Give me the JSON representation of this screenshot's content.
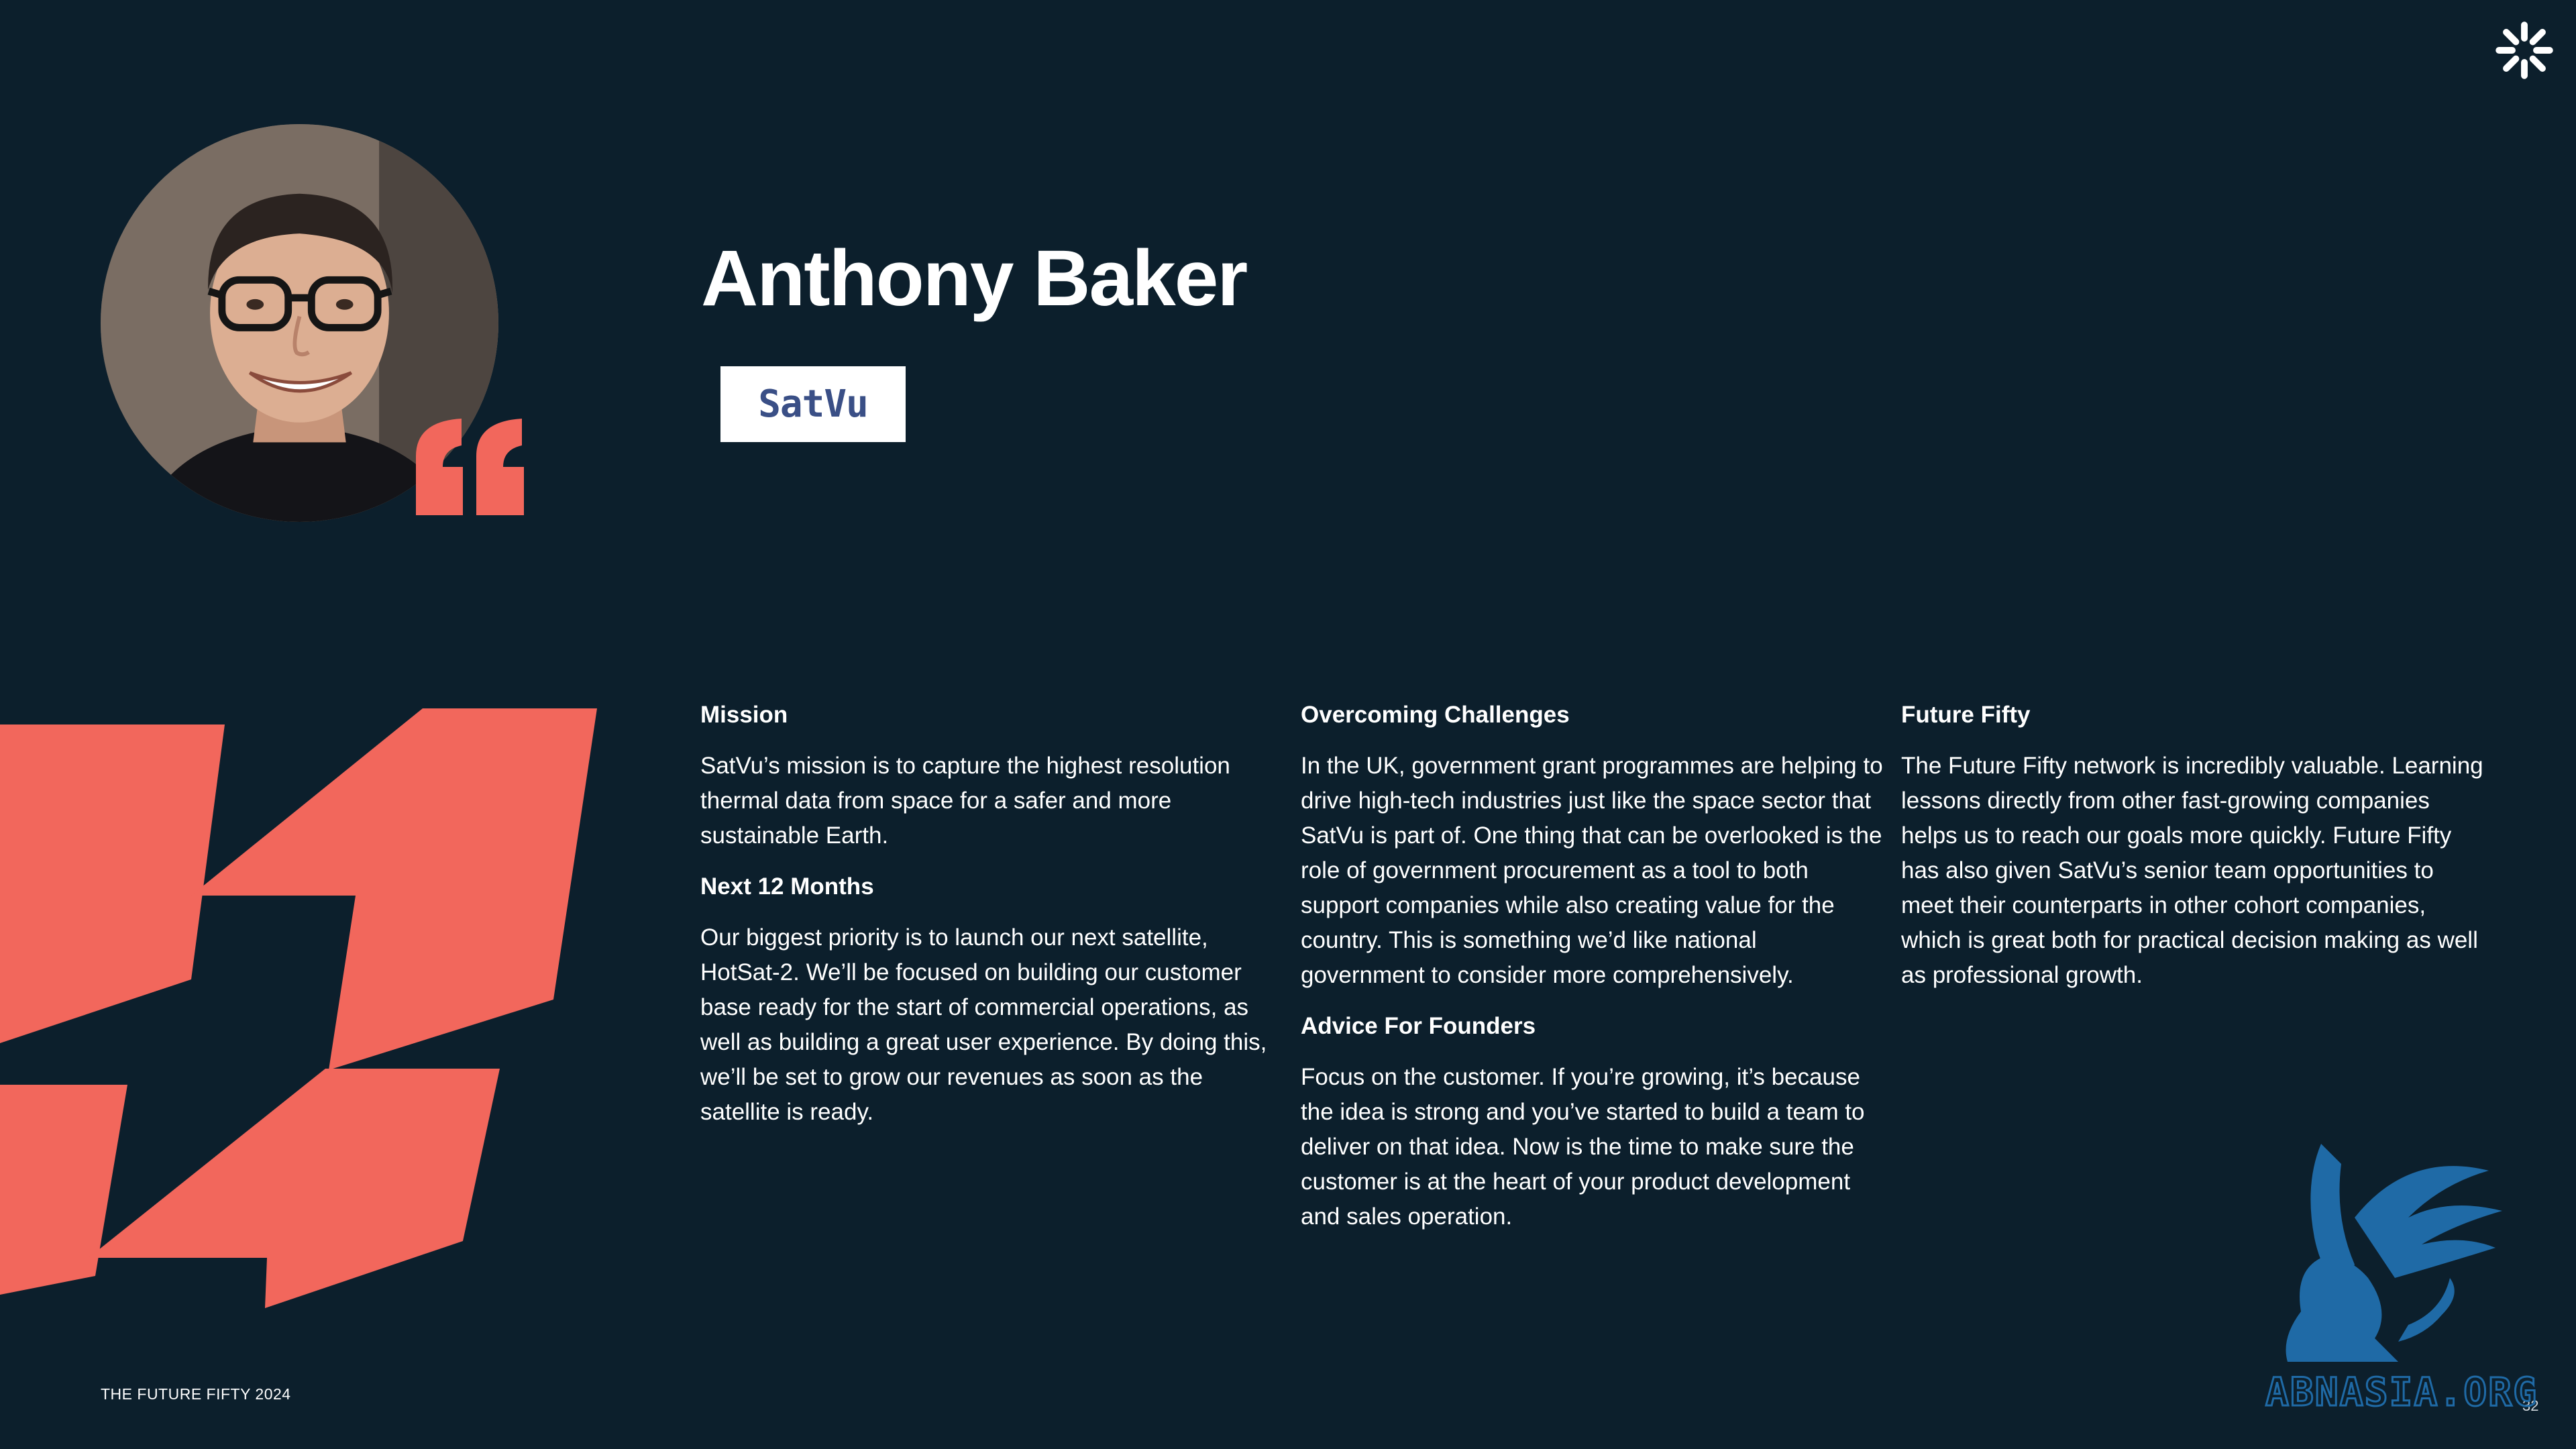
{
  "profile": {
    "name": "Anthony Baker",
    "company_logo_text": "SatVu"
  },
  "sections": {
    "mission": {
      "heading": "Mission",
      "body": "SatVu’s mission is to capture the highest resolution thermal data from space for a safer and more sustainable Earth."
    },
    "next_12_months": {
      "heading": "Next 12 Months",
      "body": "Our biggest priority is to launch our next satellite, HotSat-2. We’ll be focused on building our customer base ready for the start of commercial operations, as well as building a great user experience. By doing this, we’ll be set to grow our revenues as soon as the satellite is ready."
    },
    "overcoming_challenges": {
      "heading": "Overcoming Challenges",
      "body": "In the UK, government grant programmes are helping to drive high-tech industries just like the space sector that SatVu is part of. One thing that can be overlooked is the role of government procurement as a tool to both support companies while also creating value for the country. This is something we’d like national government to consider more comprehensively."
    },
    "advice_for_founders": {
      "heading": "Advice For Founders",
      "body": "Focus on the customer. If you’re growing, it’s because the idea is strong and you’ve started to build a team to deliver on that idea. Now is the time to make sure the customer is at the heart of your product development and sales operation."
    },
    "future_fifty": {
      "heading": "Future Fifty",
      "body": "The Future Fifty network is incredibly valuable. Learning lessons directly from other fast-growing companies helps us to reach our goals more quickly. Future Fifty has also given SatVu’s senior team opportunities to meet their counterparts in other cohort companies, which is great both for practical decision making as well as professional growth."
    }
  },
  "footer": {
    "label": "THE FUTURE FIFTY 2024",
    "page_number": "32"
  },
  "watermark": {
    "text": "ABNASIA.ORG"
  },
  "colors": {
    "background": "#0c1f2c",
    "accent": "#f2675c",
    "text": "#ffffff",
    "watermark": "#1f6aa6"
  }
}
